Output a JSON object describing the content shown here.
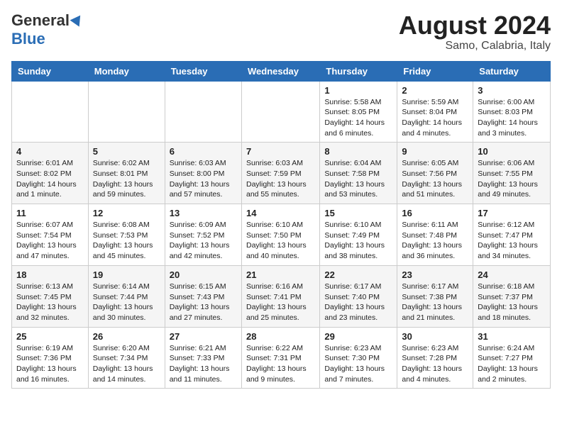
{
  "header": {
    "logo_general": "General",
    "logo_blue": "Blue",
    "title": "August 2024",
    "subtitle": "Samo, Calabria, Italy"
  },
  "weekdays": [
    "Sunday",
    "Monday",
    "Tuesday",
    "Wednesday",
    "Thursday",
    "Friday",
    "Saturday"
  ],
  "weeks": [
    [
      {
        "day": "",
        "info": ""
      },
      {
        "day": "",
        "info": ""
      },
      {
        "day": "",
        "info": ""
      },
      {
        "day": "",
        "info": ""
      },
      {
        "day": "1",
        "info": "Sunrise: 5:58 AM\nSunset: 8:05 PM\nDaylight: 14 hours\nand 6 minutes."
      },
      {
        "day": "2",
        "info": "Sunrise: 5:59 AM\nSunset: 8:04 PM\nDaylight: 14 hours\nand 4 minutes."
      },
      {
        "day": "3",
        "info": "Sunrise: 6:00 AM\nSunset: 8:03 PM\nDaylight: 14 hours\nand 3 minutes."
      }
    ],
    [
      {
        "day": "4",
        "info": "Sunrise: 6:01 AM\nSunset: 8:02 PM\nDaylight: 14 hours\nand 1 minute."
      },
      {
        "day": "5",
        "info": "Sunrise: 6:02 AM\nSunset: 8:01 PM\nDaylight: 13 hours\nand 59 minutes."
      },
      {
        "day": "6",
        "info": "Sunrise: 6:03 AM\nSunset: 8:00 PM\nDaylight: 13 hours\nand 57 minutes."
      },
      {
        "day": "7",
        "info": "Sunrise: 6:03 AM\nSunset: 7:59 PM\nDaylight: 13 hours\nand 55 minutes."
      },
      {
        "day": "8",
        "info": "Sunrise: 6:04 AM\nSunset: 7:58 PM\nDaylight: 13 hours\nand 53 minutes."
      },
      {
        "day": "9",
        "info": "Sunrise: 6:05 AM\nSunset: 7:56 PM\nDaylight: 13 hours\nand 51 minutes."
      },
      {
        "day": "10",
        "info": "Sunrise: 6:06 AM\nSunset: 7:55 PM\nDaylight: 13 hours\nand 49 minutes."
      }
    ],
    [
      {
        "day": "11",
        "info": "Sunrise: 6:07 AM\nSunset: 7:54 PM\nDaylight: 13 hours\nand 47 minutes."
      },
      {
        "day": "12",
        "info": "Sunrise: 6:08 AM\nSunset: 7:53 PM\nDaylight: 13 hours\nand 45 minutes."
      },
      {
        "day": "13",
        "info": "Sunrise: 6:09 AM\nSunset: 7:52 PM\nDaylight: 13 hours\nand 42 minutes."
      },
      {
        "day": "14",
        "info": "Sunrise: 6:10 AM\nSunset: 7:50 PM\nDaylight: 13 hours\nand 40 minutes."
      },
      {
        "day": "15",
        "info": "Sunrise: 6:10 AM\nSunset: 7:49 PM\nDaylight: 13 hours\nand 38 minutes."
      },
      {
        "day": "16",
        "info": "Sunrise: 6:11 AM\nSunset: 7:48 PM\nDaylight: 13 hours\nand 36 minutes."
      },
      {
        "day": "17",
        "info": "Sunrise: 6:12 AM\nSunset: 7:47 PM\nDaylight: 13 hours\nand 34 minutes."
      }
    ],
    [
      {
        "day": "18",
        "info": "Sunrise: 6:13 AM\nSunset: 7:45 PM\nDaylight: 13 hours\nand 32 minutes."
      },
      {
        "day": "19",
        "info": "Sunrise: 6:14 AM\nSunset: 7:44 PM\nDaylight: 13 hours\nand 30 minutes."
      },
      {
        "day": "20",
        "info": "Sunrise: 6:15 AM\nSunset: 7:43 PM\nDaylight: 13 hours\nand 27 minutes."
      },
      {
        "day": "21",
        "info": "Sunrise: 6:16 AM\nSunset: 7:41 PM\nDaylight: 13 hours\nand 25 minutes."
      },
      {
        "day": "22",
        "info": "Sunrise: 6:17 AM\nSunset: 7:40 PM\nDaylight: 13 hours\nand 23 minutes."
      },
      {
        "day": "23",
        "info": "Sunrise: 6:17 AM\nSunset: 7:38 PM\nDaylight: 13 hours\nand 21 minutes."
      },
      {
        "day": "24",
        "info": "Sunrise: 6:18 AM\nSunset: 7:37 PM\nDaylight: 13 hours\nand 18 minutes."
      }
    ],
    [
      {
        "day": "25",
        "info": "Sunrise: 6:19 AM\nSunset: 7:36 PM\nDaylight: 13 hours\nand 16 minutes."
      },
      {
        "day": "26",
        "info": "Sunrise: 6:20 AM\nSunset: 7:34 PM\nDaylight: 13 hours\nand 14 minutes."
      },
      {
        "day": "27",
        "info": "Sunrise: 6:21 AM\nSunset: 7:33 PM\nDaylight: 13 hours\nand 11 minutes."
      },
      {
        "day": "28",
        "info": "Sunrise: 6:22 AM\nSunset: 7:31 PM\nDaylight: 13 hours\nand 9 minutes."
      },
      {
        "day": "29",
        "info": "Sunrise: 6:23 AM\nSunset: 7:30 PM\nDaylight: 13 hours\nand 7 minutes."
      },
      {
        "day": "30",
        "info": "Sunrise: 6:23 AM\nSunset: 7:28 PM\nDaylight: 13 hours\nand 4 minutes."
      },
      {
        "day": "31",
        "info": "Sunrise: 6:24 AM\nSunset: 7:27 PM\nDaylight: 13 hours\nand 2 minutes."
      }
    ]
  ]
}
